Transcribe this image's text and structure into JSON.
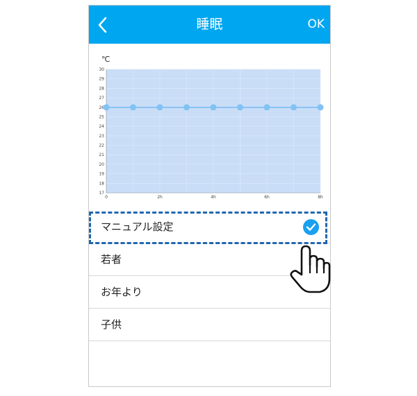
{
  "header": {
    "back_icon": "chevron-left-icon",
    "title": "睡眠",
    "ok_label": "OK"
  },
  "chart_data": {
    "type": "line",
    "ylabel": "℃",
    "ylim": [
      17,
      30
    ],
    "yticks": [
      17,
      18,
      19,
      20,
      21,
      22,
      23,
      24,
      25,
      26,
      27,
      28,
      29,
      30
    ],
    "xlim": [
      0,
      8
    ],
    "xtick_labels": [
      "0",
      "2h",
      "4h",
      "6h",
      "8h"
    ],
    "x": [
      0,
      1,
      2,
      3,
      4,
      5,
      6,
      7,
      8
    ],
    "series": [
      {
        "values": [
          26,
          26,
          26,
          26,
          26,
          26,
          26,
          26,
          26
        ]
      }
    ]
  },
  "list": {
    "items": [
      {
        "label": "マニュアル設定",
        "selected": true
      },
      {
        "label": "若者",
        "selected": false
      },
      {
        "label": "お年より",
        "selected": false
      },
      {
        "label": "子供",
        "selected": false
      }
    ]
  },
  "colors": {
    "header": "#00a6f0",
    "chart_fill": "#c9ddf7",
    "point": "#82c2f5",
    "highlight": "#1f66b1",
    "check": "#1aa1ef"
  },
  "icons": {
    "check": "check-circle-icon",
    "hand": "pointing-hand-icon"
  }
}
